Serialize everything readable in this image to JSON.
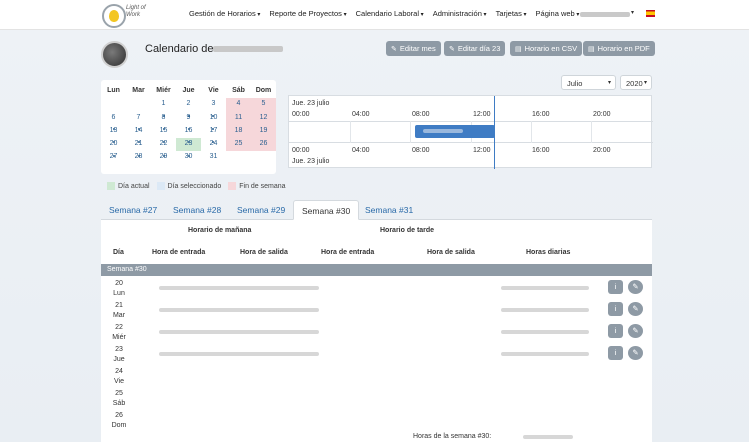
{
  "nav": {
    "logo_text": "Light of Work",
    "items": [
      "Gestión de Horarios",
      "Reporte de Proyectos",
      "Calendario Laboral",
      "Administración",
      "Tarjetas",
      "Página web"
    ]
  },
  "header": {
    "title": "Calendario de",
    "buttons": [
      {
        "icon": "✎",
        "label": "Editar mes"
      },
      {
        "icon": "✎",
        "label": "Editar día 23"
      },
      {
        "icon": "▤",
        "label": "Horario en CSV"
      },
      {
        "icon": "▤",
        "label": "Horario en PDF"
      }
    ]
  },
  "selectors": {
    "month": "Julio",
    "year": "2020"
  },
  "calendar": {
    "weekdays": [
      "Lun",
      "Mar",
      "Miér",
      "Jue",
      "Vie",
      "Sáb",
      "Dom"
    ],
    "rows": [
      [
        "",
        "",
        "1",
        "2",
        "3",
        "4",
        "5"
      ],
      [
        "6",
        "7",
        "8",
        "9",
        "10",
        "11",
        "12"
      ],
      [
        "13",
        "14",
        "15",
        "16",
        "17",
        "18",
        "19"
      ],
      [
        "20",
        "21",
        "22",
        "23",
        "24",
        "25",
        "26"
      ],
      [
        "27",
        "28",
        "29",
        "30",
        "31",
        "",
        ""
      ]
    ]
  },
  "legend": [
    "Día actual",
    "Día seleccionado",
    "Fin de semana"
  ],
  "legend_colors": {
    "today": "#cfe9d3",
    "selected": "#dce9f6",
    "weekend": "#f6d7da"
  },
  "timeline": {
    "date_top": "Jue. 23 julio",
    "date_bottom": "Jue. 23 julio",
    "hours": [
      "00:00",
      "04:00",
      "08:00",
      "12:00",
      "16:00",
      "20:00"
    ]
  },
  "tabs": [
    "Semana #27",
    "Semana #28",
    "Semana #29",
    "Semana #30",
    "Semana #31"
  ],
  "active_tab": "Semana #30",
  "table": {
    "group_morning": "Horario de mañana",
    "group_afternoon": "Horario de tarde",
    "columns": [
      "Día",
      "Hora de entrada",
      "Hora de salida",
      "Hora de entrada",
      "Hora de salida",
      "Horas diarias"
    ],
    "week_label": "Semana #30",
    "days": [
      {
        "num": "20",
        "name": "Lun"
      },
      {
        "num": "21",
        "name": "Mar"
      },
      {
        "num": "22",
        "name": "Miér"
      },
      {
        "num": "23",
        "name": "Jue"
      },
      {
        "num": "24",
        "name": "Vie"
      },
      {
        "num": "25",
        "name": "Sáb"
      },
      {
        "num": "26",
        "name": "Dom"
      }
    ],
    "info_icon": "i",
    "edit_icon": "✎",
    "footer_label": "Horas de la semana #30:"
  }
}
